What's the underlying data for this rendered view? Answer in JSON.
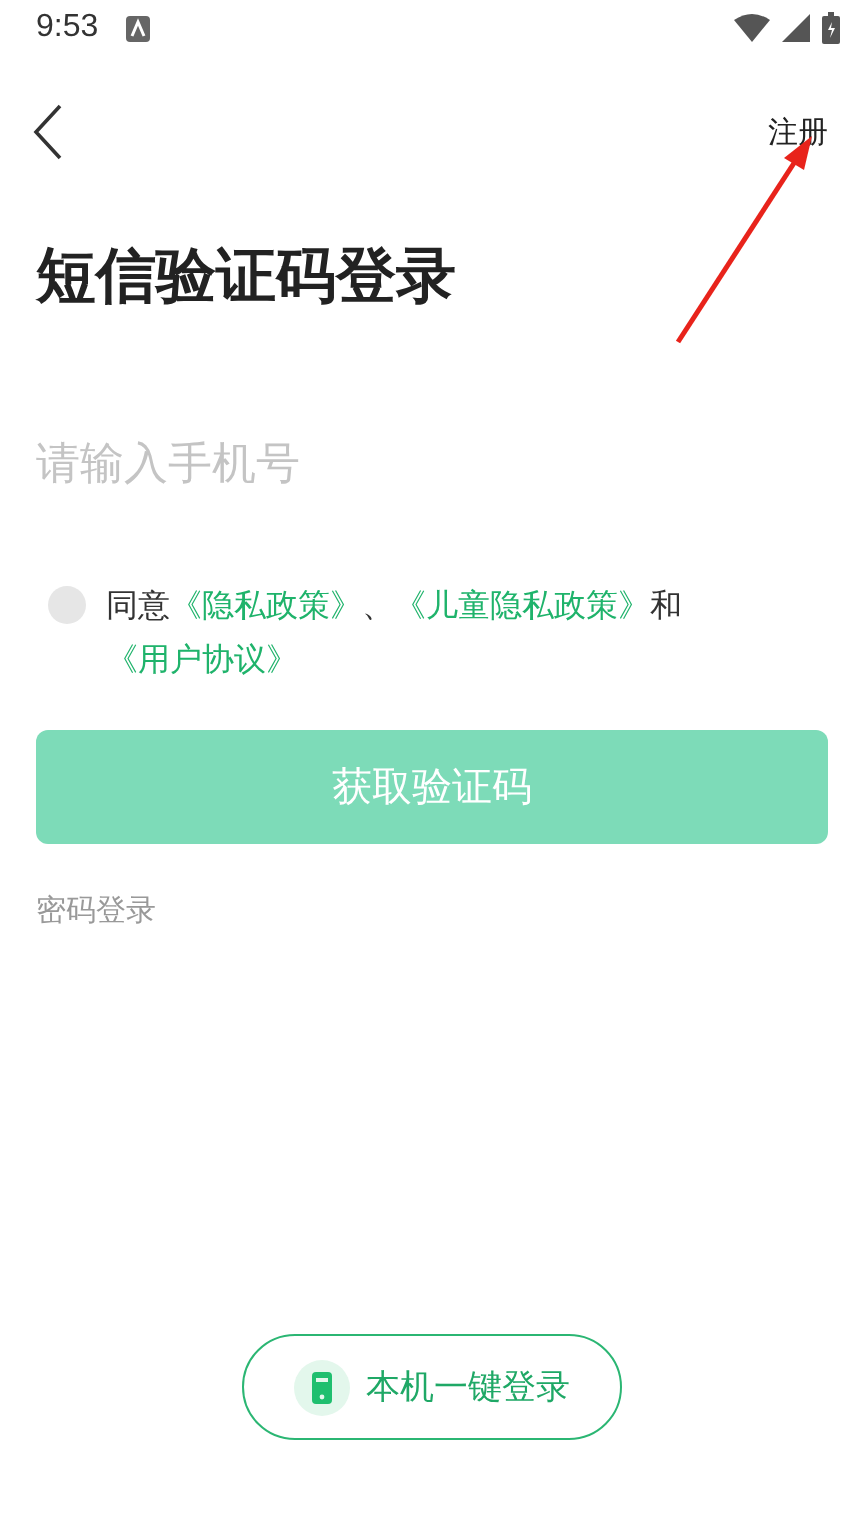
{
  "status_bar": {
    "time": "9:53"
  },
  "header": {
    "register_link": "注册"
  },
  "title": "短信验证码登录",
  "phone_field": {
    "placeholder": "请输入手机号"
  },
  "consent": {
    "checked": false,
    "segments": [
      {
        "kind": "text",
        "text": "同意"
      },
      {
        "kind": "link",
        "text": "《隐私政策》"
      },
      {
        "kind": "text",
        "text": "、"
      },
      {
        "kind": "link",
        "text": "《儿童隐私政策》"
      },
      {
        "kind": "text",
        "text": "和"
      },
      {
        "kind": "link",
        "text": "《用户协议》"
      }
    ]
  },
  "get_code_button": {
    "label": "获取验证码",
    "disabled": true
  },
  "password_login_link": "密码登录",
  "one_tap_button": {
    "label": "本机一键登录"
  }
}
